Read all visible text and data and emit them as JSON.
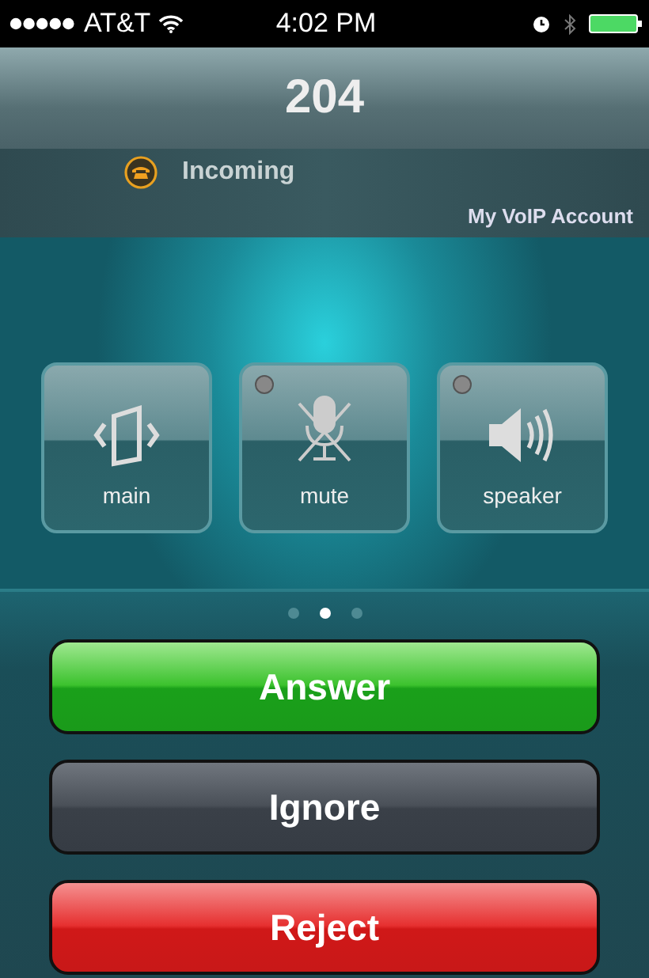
{
  "status_bar": {
    "carrier": "AT&T",
    "time": "4:02 PM"
  },
  "call": {
    "number": "204",
    "state": "Incoming",
    "account": "My VoIP Account"
  },
  "controls": [
    {
      "kind": "main",
      "label": "main"
    },
    {
      "kind": "mute",
      "label": "mute",
      "led_on": false
    },
    {
      "kind": "speaker",
      "label": "speaker",
      "led_on": false
    }
  ],
  "pages": [
    {
      "selected": false
    },
    {
      "selected": true
    },
    {
      "selected": false
    }
  ],
  "actions": [
    {
      "kind": "answer",
      "label": "Answer"
    },
    {
      "kind": "ignore",
      "label": "Ignore"
    },
    {
      "kind": "reject",
      "label": "Reject"
    }
  ]
}
